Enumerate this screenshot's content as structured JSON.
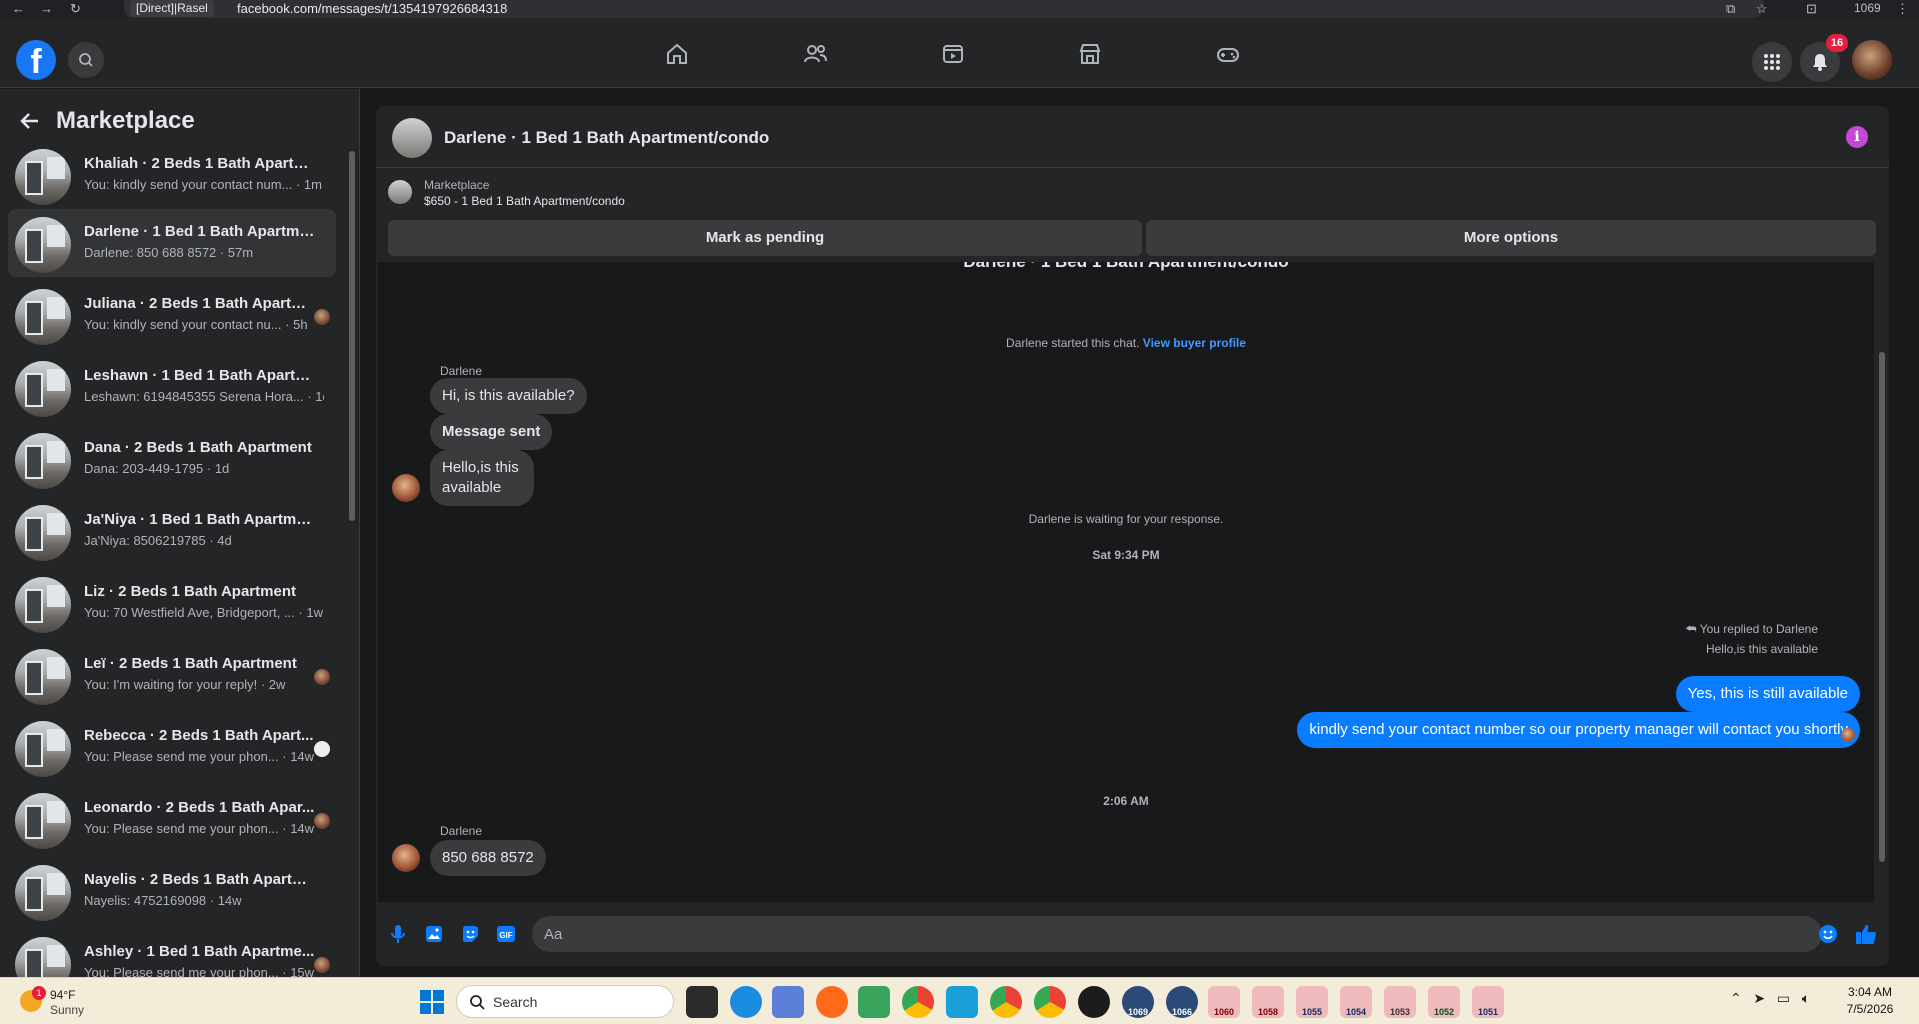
{
  "browser": {
    "profile_label": "[Direct]|Rasel",
    "url": "facebook.com/messages/t/1354197926684318",
    "counter": "1069"
  },
  "header": {
    "notifications_count": "16"
  },
  "sidebar": {
    "title": "Marketplace",
    "conversations": [
      {
        "name": "Khaliah · 2 Beds 1 Bath Apartment",
        "preview": "You: kindly send your contact num... · 1m"
      },
      {
        "name": "Darlene · 1 Bed 1 Bath Apartmen...",
        "preview": "Darlene: 850 688 8572 · 57m"
      },
      {
        "name": "Juliana · 2 Beds 1 Bath Apartm...",
        "preview": "You: kindly send your contact nu... · 5h"
      },
      {
        "name": "Leshawn · 1 Bed 1 Bath Apartme...",
        "preview": "Leshawn: 6194845355 Serena Hora... · 1d"
      },
      {
        "name": "Dana · 2 Beds 1 Bath Apartment",
        "preview": "Dana: 203-449-1795 · 1d"
      },
      {
        "name": "Ja'Niya · 1 Bed 1 Bath Apartment...",
        "preview": "Ja'Niya: 8506219785 · 4d"
      },
      {
        "name": "Liz · 2 Beds 1 Bath Apartment",
        "preview": "You: 70 Westfield Ave, Bridgeport, ... · 1w"
      },
      {
        "name": "Leï · 2 Beds 1 Bath Apartment",
        "preview": "You: I'm waiting for your reply! · 2w"
      },
      {
        "name": "Rebecca · 2 Beds 1 Bath Apart...",
        "preview": "You: Please send me your phon... · 14w"
      },
      {
        "name": "Leonardo · 2 Beds 1 Bath Apar...",
        "preview": "You: Please send me your phon... · 14w"
      },
      {
        "name": "Nayelis · 2 Beds 1 Bath Apartment",
        "preview": "Nayelis: 4752169098 · 14w"
      },
      {
        "name": "Ashley · 1 Bed 1 Bath Apartme...",
        "preview": "You: Please send me your phon... · 15w"
      }
    ]
  },
  "chat": {
    "title": "Darlene · 1 Bed 1 Bath Apartment/condo",
    "listing_label": "Marketplace",
    "listing_price": "$650 - 1 Bed 1 Bath Apartment/condo",
    "mark_pending_label": "Mark as pending",
    "more_options_label": "More options",
    "started_text": "Darlene started this chat.",
    "view_profile_label": "View buyer profile",
    "sender_name": "Darlene",
    "incoming_1": "Hi, is this available?",
    "incoming_2": "Message sent",
    "incoming_3": "Hello,is this available",
    "waiting_text": "Darlene is waiting for your response.",
    "timestamp_1": "Sat 9:34 PM",
    "replied_note": "You replied to Darlene",
    "reply_quote": "Hello,is this available",
    "outgoing_1": "Yes, this is still available",
    "outgoing_2": "kindly send your contact number so our property manager will contact you shortly",
    "timestamp_2": "2:06 AM",
    "incoming_4": "850 688 8572",
    "input_placeholder": "Aa"
  },
  "taskbar": {
    "weather_alert": "1",
    "temperature": "94°F",
    "condition": "Sunny",
    "search_label": "Search",
    "badges": [
      "1069",
      "1066",
      "1060",
      "1058",
      "1055",
      "1054",
      "1053",
      "1052",
      "1051"
    ],
    "time": "3:04 AM",
    "date": "7/5/2026"
  },
  "colors": {
    "accent": "#0a7cff",
    "fb_blue": "#1877f2",
    "info_purple": "#c24ad4",
    "badge_red": "#e41e3f"
  }
}
